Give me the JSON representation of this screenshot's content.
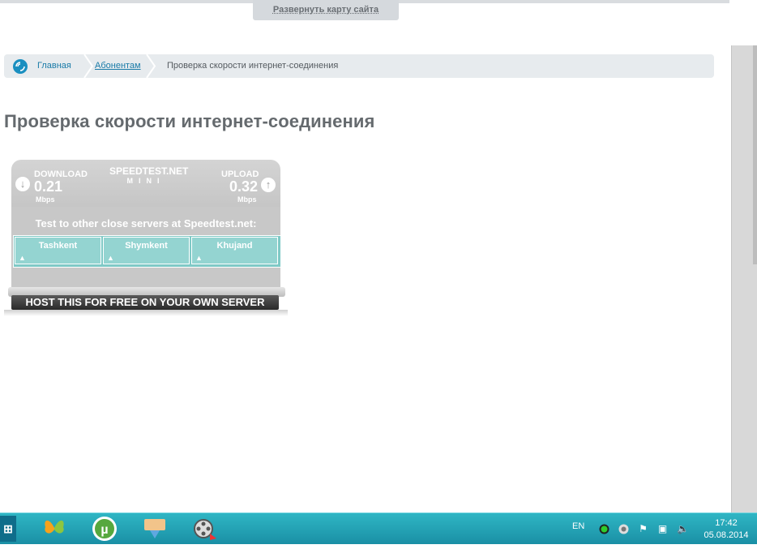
{
  "header": {
    "sitemap_label": "Развернуть карту сайта"
  },
  "breadcrumb": {
    "home": "Главная",
    "subscribers": "Абонентам",
    "current": "Проверка скорости интернет-соединения"
  },
  "page_title": "Проверка скорости интернет-соединения",
  "speedtest": {
    "download_label": "DOWNLOAD",
    "download_value": "0.21",
    "download_unit": "Mbps",
    "logo_top": "SPEEDTEST.NET",
    "logo_bottom": "MINI",
    "upload_label": "UPLOAD",
    "upload_value": "0.32",
    "upload_unit": "Mbps",
    "test_text": "Test to other close servers at Speedtest.net:",
    "servers": [
      "Tashkent",
      "Shymkent",
      "Khujand"
    ],
    "host_label": "HOST THIS FOR FREE ON YOUR OWN SERVER"
  },
  "taskbar": {
    "apps": [
      "butterfly-app-icon",
      "utorrent-icon",
      "network-transfer-icon",
      "media-player-icon"
    ],
    "language": "EN",
    "time": "17:42",
    "date": "05.08.2014"
  },
  "colors": {
    "link": "#1a7ba8",
    "taskbar": "#1a8fa5",
    "speedtest_teal": "#7fc9c6"
  }
}
